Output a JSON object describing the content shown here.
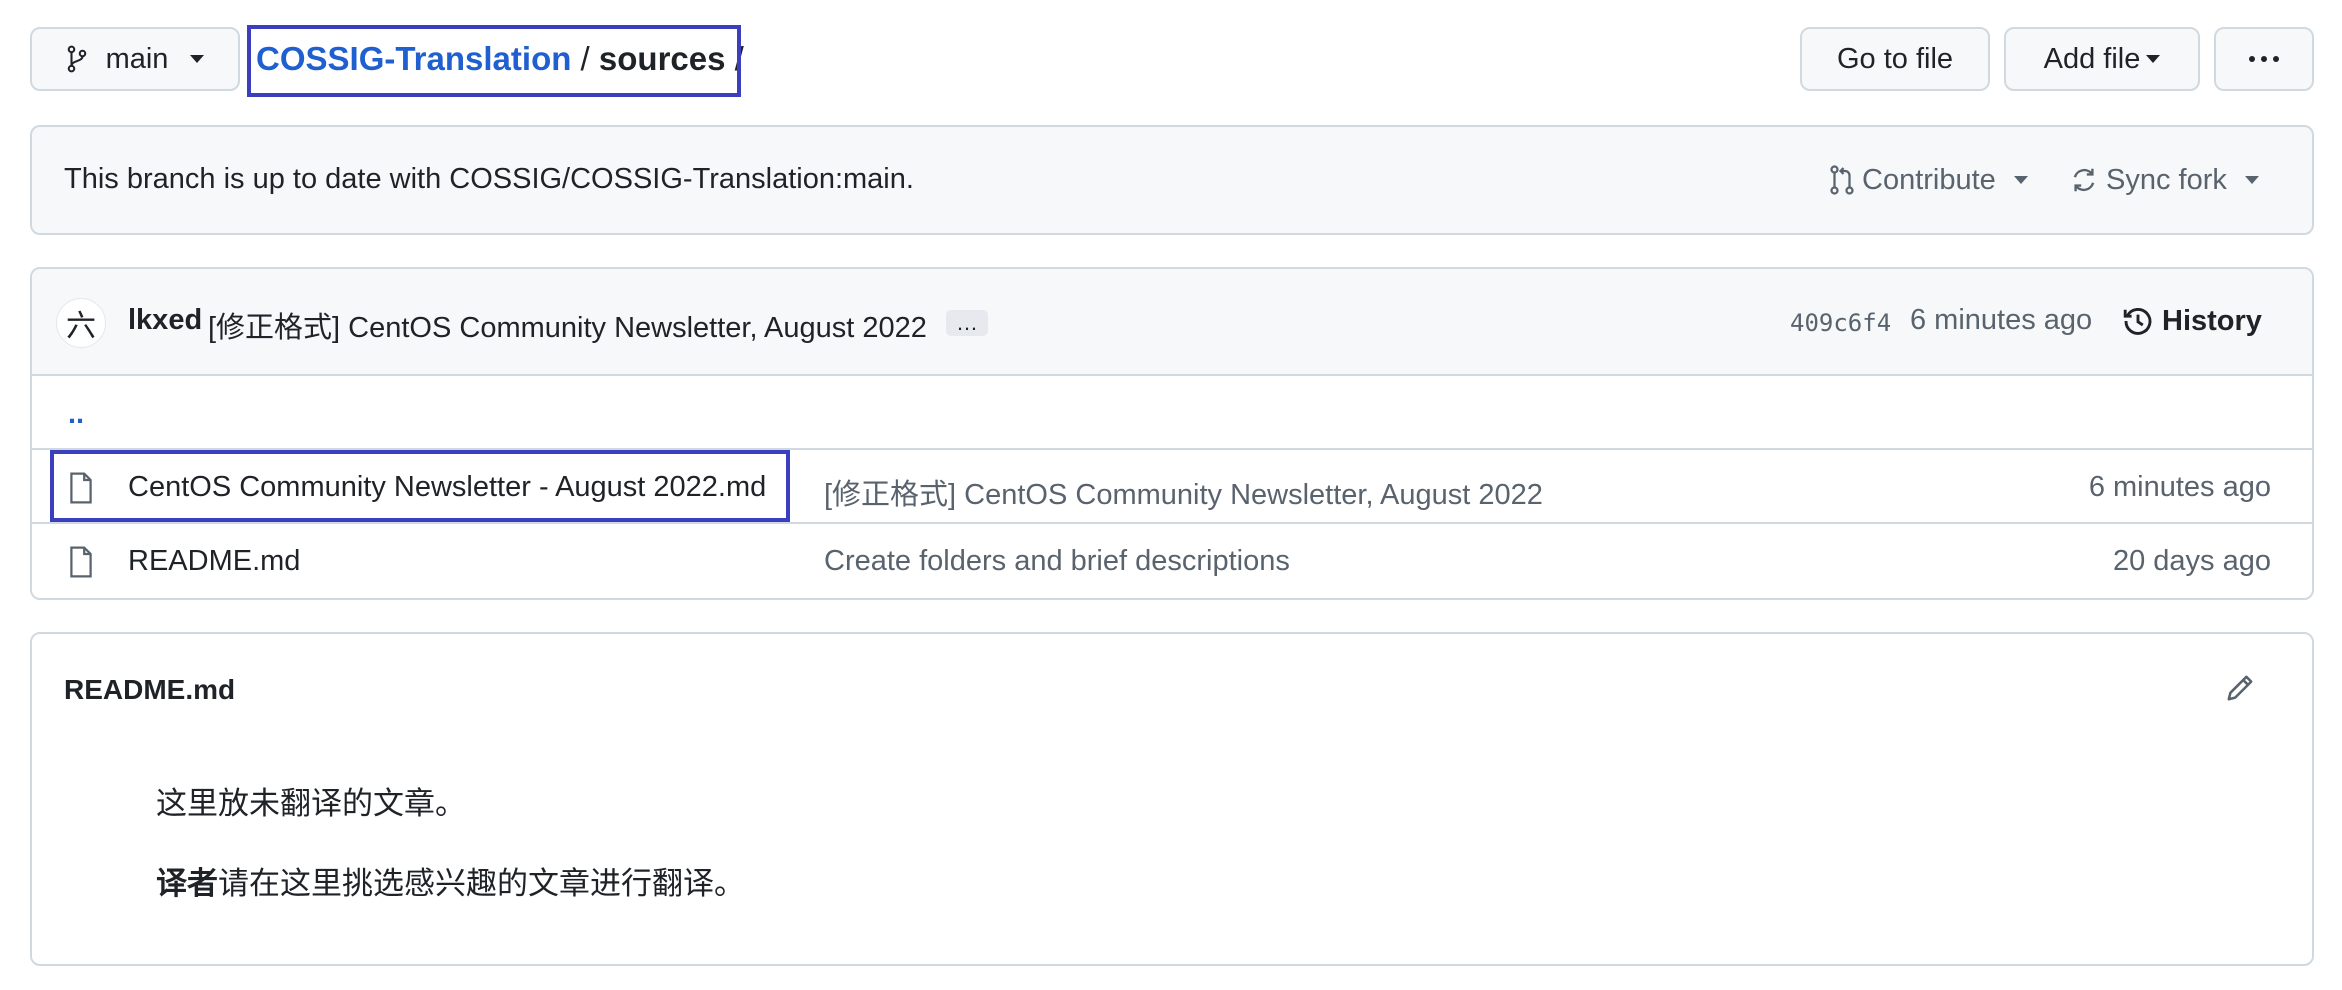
{
  "branch": {
    "name": "main"
  },
  "breadcrumb": {
    "repo": "COSSIG-Translation",
    "sep1": " / ",
    "folder": "sources",
    "sep2": " /"
  },
  "toolbar": {
    "go_to_file": "Go to file",
    "add_file": "Add file",
    "more": "···"
  },
  "fork_status": {
    "message": "This branch is up to date with COSSIG/COSSIG-Translation:main.",
    "contribute": "Contribute",
    "sync_fork": "Sync fork"
  },
  "latest_commit": {
    "avatar_glyph": "六",
    "author": "lkxed",
    "message": "[修正格式] CentOS Community Newsletter, August 2022",
    "ellipsis": "…",
    "hash": "409c6f4",
    "time": "6 minutes ago",
    "history": "History"
  },
  "files": {
    "parent": "..",
    "rows": [
      {
        "name": "CentOS Community Newsletter - August 2022.md",
        "commit": "[修正格式] CentOS Community Newsletter, August 2022",
        "time": "6 minutes ago"
      },
      {
        "name": "README.md",
        "commit": "Create folders and brief descriptions",
        "time": "20 days ago"
      }
    ]
  },
  "readme": {
    "title": "README.md",
    "line1": "这里放未翻译的文章。",
    "line2_bold": "译者",
    "line2_rest": "请在这里挑选感兴趣的文章进行翻译。"
  },
  "colors": {
    "link": "#0969da",
    "highlight": "#3b3fbf",
    "border": "#d1d9e0",
    "muted": "#59636e"
  },
  "icons": [
    "git-branch-icon",
    "caret-down-icon",
    "kebab-icon",
    "pull-request-icon",
    "sync-icon",
    "history-icon",
    "file-icon",
    "pencil-icon"
  ]
}
